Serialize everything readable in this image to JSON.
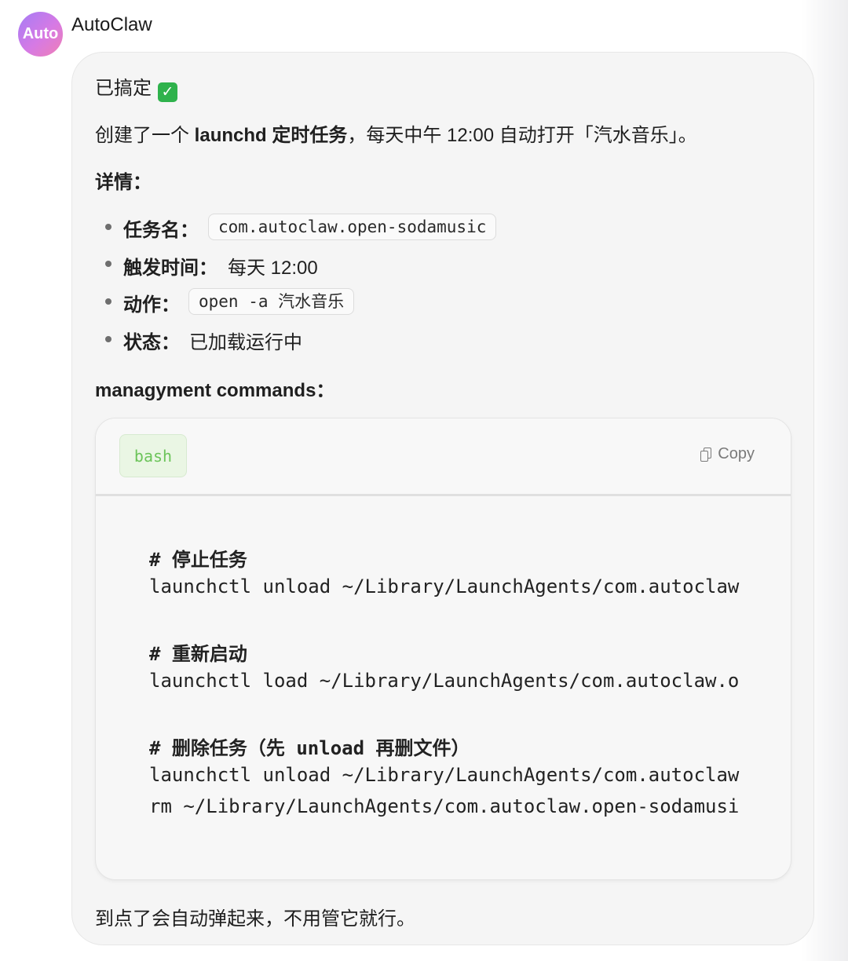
{
  "avatar": {
    "label": "Auto",
    "gradient": [
      "#a57cf6",
      "#f07fb4"
    ]
  },
  "sender": {
    "name": "AutoClaw"
  },
  "message": {
    "status_text": "已搞定",
    "status_icon": "check-mark-button-icon",
    "intro": {
      "prefix": "创建了一个 ",
      "bold": "launchd 定时任务",
      "suffix": "，每天中午 12:00 自动打开「汽水音乐」。"
    },
    "details_heading": "详情：",
    "details": [
      {
        "label": "任务名：",
        "value": "com.autoclaw.open-sodamusic",
        "code": true
      },
      {
        "label": "触发时间：",
        "value": "每天 12:00",
        "code": false
      },
      {
        "label": "动作：",
        "value": "open -a 汽水音乐",
        "code": true
      },
      {
        "label": "状态：",
        "value": "已加载运行中",
        "code": false
      }
    ],
    "commands_heading": "managyment commands：",
    "code_block": {
      "language": "bash",
      "copy_label": "Copy",
      "lines": [
        "# 停止任务",
        "launchctl unload ~/Library/LaunchAgents/com.autoclaw",
        "",
        "# 重新启动",
        "launchctl load ~/Library/LaunchAgents/com.autoclaw.o",
        "",
        "# 删除任务（先 unload 再删文件）",
        "launchctl unload ~/Library/LaunchAgents/com.autoclaw",
        "rm ~/Library/LaunchAgents/com.autoclaw.open-sodamusi"
      ]
    },
    "footer": "到点了会自动弹起来，不用管它就行。"
  }
}
